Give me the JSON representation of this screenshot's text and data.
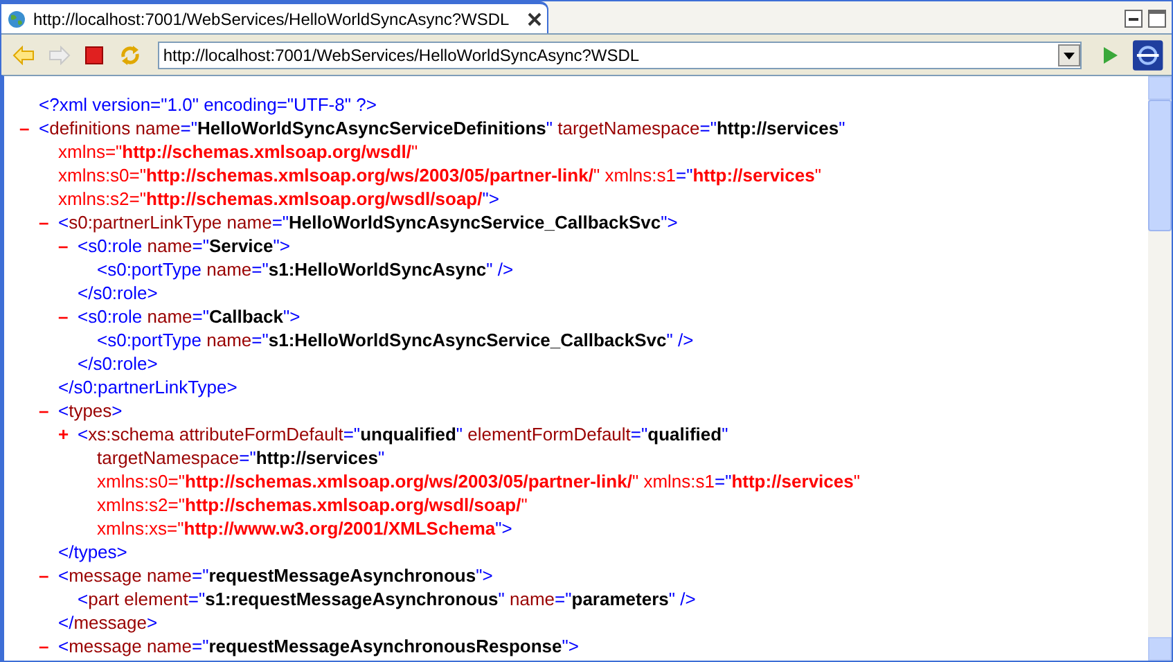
{
  "tab": {
    "title": "http://localhost:7001/WebServices/HelloWorldSyncAsync?WSDL",
    "selected": true
  },
  "toolbar": {
    "buttons": [
      {
        "kind": "back",
        "disabled": false
      },
      {
        "kind": "forward",
        "disabled": true
      },
      {
        "kind": "stop",
        "disabled": false
      },
      {
        "kind": "refresh",
        "disabled": false
      }
    ],
    "url": "http://localhost:7001/WebServices/HelloWorldSyncAsync?WSDL"
  },
  "document": [
    {
      "lines": [
        [
          {
            "kind": "p",
            "text": "<?xml version=\"1.0\" encoding=\"UTF-8\" ?>"
          }
        ]
      ]
    },
    {
      "toggle": "–",
      "lines": [
        [
          {
            "kind": "p",
            "text": "<"
          },
          {
            "kind": "t",
            "text": "definitions"
          },
          {
            "kind": "a",
            "text": " name"
          },
          {
            "kind": "p",
            "text": "=\""
          },
          {
            "kind": "v",
            "text": "HelloWorldSyncAsyncServiceDefinitions"
          },
          {
            "kind": "p",
            "text": "\""
          },
          {
            "kind": "a",
            "text": " targetNamespace"
          },
          {
            "kind": "p",
            "text": "=\""
          },
          {
            "kind": "v",
            "text": "http://services"
          },
          {
            "kind": "p",
            "text": "\""
          }
        ],
        [
          {
            "kind": "na",
            "text": "xmlns=\""
          },
          {
            "kind": "nv",
            "text": "http://schemas.xmlsoap.org/wsdl/"
          },
          {
            "kind": "na",
            "text": "\""
          }
        ],
        [
          {
            "kind": "na",
            "text": "xmlns:s0=\""
          },
          {
            "kind": "nv",
            "text": "http://schemas.xmlsoap.org/ws/2003/05/partner-link/"
          },
          {
            "kind": "na",
            "text": "\""
          },
          {
            "kind": "na",
            "text": " xmlns:s1"
          },
          {
            "kind": "p",
            "text": "=\""
          },
          {
            "kind": "nv",
            "text": "http://services"
          },
          {
            "kind": "na",
            "text": "\""
          }
        ],
        [
          {
            "kind": "na",
            "text": "xmlns:s2=\""
          },
          {
            "kind": "nv",
            "text": "http://schemas.xmlsoap.org/wsdl/soap/"
          },
          {
            "kind": "p",
            "text": "\">"
          }
        ]
      ],
      "children": [
        {
          "toggle": "–",
          "lines": [
            [
              {
                "kind": "p",
                "text": "<"
              },
              {
                "kind": "t",
                "text": "s0:partnerLinkType"
              },
              {
                "kind": "a",
                "text": " name"
              },
              {
                "kind": "p",
                "text": "=\""
              },
              {
                "kind": "v",
                "text": "HelloWorldSyncAsyncService_CallbackSvc"
              },
              {
                "kind": "p",
                "text": "\">"
              }
            ]
          ],
          "children": [
            {
              "toggle": "–",
              "lines": [
                [
                  {
                    "kind": "p",
                    "text": "<s0:role"
                  },
                  {
                    "kind": "a",
                    "text": " name"
                  },
                  {
                    "kind": "p",
                    "text": "=\""
                  },
                  {
                    "kind": "v",
                    "text": "Service"
                  },
                  {
                    "kind": "p",
                    "text": "\">"
                  }
                ]
              ],
              "children": [
                {
                  "lines": [
                    [
                      {
                        "kind": "p",
                        "text": "<s0:portType"
                      },
                      {
                        "kind": "a",
                        "text": " name"
                      },
                      {
                        "kind": "p",
                        "text": "=\""
                      },
                      {
                        "kind": "v",
                        "text": "s1:HelloWorldSyncAsync"
                      },
                      {
                        "kind": "p",
                        "text": "\" />"
                      }
                    ]
                  ]
                }
              ],
              "close": [
                {
                  "kind": "p",
                  "text": "</s0:role>"
                }
              ]
            },
            {
              "toggle": "–",
              "lines": [
                [
                  {
                    "kind": "p",
                    "text": "<s0:role"
                  },
                  {
                    "kind": "a",
                    "text": " name"
                  },
                  {
                    "kind": "p",
                    "text": "=\""
                  },
                  {
                    "kind": "v",
                    "text": "Callback"
                  },
                  {
                    "kind": "p",
                    "text": "\">"
                  }
                ]
              ],
              "children": [
                {
                  "lines": [
                    [
                      {
                        "kind": "p",
                        "text": "<s0:portType"
                      },
                      {
                        "kind": "a",
                        "text": " name"
                      },
                      {
                        "kind": "p",
                        "text": "=\""
                      },
                      {
                        "kind": "v",
                        "text": "s1:HelloWorldSyncAsyncService_CallbackSvc"
                      },
                      {
                        "kind": "p",
                        "text": "\" />"
                      }
                    ]
                  ]
                }
              ],
              "close": [
                {
                  "kind": "p",
                  "text": "</s0:role>"
                }
              ]
            }
          ],
          "close": [
            {
              "kind": "p",
              "text": "</s0:partnerLinkType>"
            }
          ]
        },
        {
          "toggle": "–",
          "lines": [
            [
              {
                "kind": "p",
                "text": "<"
              },
              {
                "kind": "t",
                "text": "types"
              },
              {
                "kind": "p",
                "text": ">"
              }
            ]
          ],
          "children": [
            {
              "toggle": "+",
              "lines": [
                [
                  {
                    "kind": "p",
                    "text": "<"
                  },
                  {
                    "kind": "t",
                    "text": "xs:schema"
                  },
                  {
                    "kind": "a",
                    "text": " attributeFormDefault"
                  },
                  {
                    "kind": "p",
                    "text": "=\""
                  },
                  {
                    "kind": "v",
                    "text": "unqualified"
                  },
                  {
                    "kind": "p",
                    "text": "\""
                  },
                  {
                    "kind": "a",
                    "text": " elementFormDefault"
                  },
                  {
                    "kind": "p",
                    "text": "=\""
                  },
                  {
                    "kind": "v",
                    "text": "qualified"
                  },
                  {
                    "kind": "p",
                    "text": "\""
                  }
                ],
                [
                  {
                    "kind": "a",
                    "text": "targetNamespace"
                  },
                  {
                    "kind": "p",
                    "text": "=\""
                  },
                  {
                    "kind": "v",
                    "text": "http://services"
                  },
                  {
                    "kind": "p",
                    "text": "\""
                  }
                ],
                [
                  {
                    "kind": "na",
                    "text": "xmlns:s0=\""
                  },
                  {
                    "kind": "nv",
                    "text": "http://schemas.xmlsoap.org/ws/2003/05/partner-link/"
                  },
                  {
                    "kind": "na",
                    "text": "\""
                  },
                  {
                    "kind": "na",
                    "text": " xmlns:s1"
                  },
                  {
                    "kind": "p",
                    "text": "=\""
                  },
                  {
                    "kind": "nv",
                    "text": "http://services"
                  },
                  {
                    "kind": "na",
                    "text": "\""
                  }
                ],
                [
                  {
                    "kind": "na",
                    "text": "xmlns:s2=\""
                  },
                  {
                    "kind": "nv",
                    "text": "http://schemas.xmlsoap.org/wsdl/soap/"
                  },
                  {
                    "kind": "na",
                    "text": "\""
                  }
                ],
                [
                  {
                    "kind": "na",
                    "text": "xmlns:xs=\""
                  },
                  {
                    "kind": "nv",
                    "text": "http://www.w3.org/2001/XMLSchema"
                  },
                  {
                    "kind": "p",
                    "text": "\">"
                  }
                ]
              ]
            }
          ],
          "close": [
            {
              "kind": "p",
              "text": "</types>"
            }
          ]
        },
        {
          "toggle": "–",
          "lines": [
            [
              {
                "kind": "p",
                "text": "<"
              },
              {
                "kind": "t",
                "text": "message"
              },
              {
                "kind": "a",
                "text": " name"
              },
              {
                "kind": "p",
                "text": "=\""
              },
              {
                "kind": "v",
                "text": "requestMessageAsynchronous"
              },
              {
                "kind": "p",
                "text": "\">"
              }
            ]
          ],
          "children": [
            {
              "lines": [
                [
                  {
                    "kind": "p",
                    "text": "<"
                  },
                  {
                    "kind": "t",
                    "text": "part"
                  },
                  {
                    "kind": "a",
                    "text": " element"
                  },
                  {
                    "kind": "p",
                    "text": "=\""
                  },
                  {
                    "kind": "v",
                    "text": "s1:requestMessageAsynchronous"
                  },
                  {
                    "kind": "p",
                    "text": "\""
                  },
                  {
                    "kind": "a",
                    "text": " name"
                  },
                  {
                    "kind": "p",
                    "text": "=\""
                  },
                  {
                    "kind": "v",
                    "text": "parameters"
                  },
                  {
                    "kind": "p",
                    "text": "\" />"
                  }
                ]
              ]
            }
          ],
          "close": [
            {
              "kind": "p",
              "text": "</"
            },
            {
              "kind": "t",
              "text": "message"
            },
            {
              "kind": "p",
              "text": ">"
            }
          ]
        },
        {
          "toggle": "–",
          "lines": [
            [
              {
                "kind": "p",
                "text": "<"
              },
              {
                "kind": "t",
                "text": "message"
              },
              {
                "kind": "a",
                "text": " name"
              },
              {
                "kind": "p",
                "text": "=\""
              },
              {
                "kind": "v",
                "text": "requestMessageAsynchronousResponse"
              },
              {
                "kind": "p",
                "text": "\">"
              }
            ]
          ]
        }
      ]
    }
  ]
}
